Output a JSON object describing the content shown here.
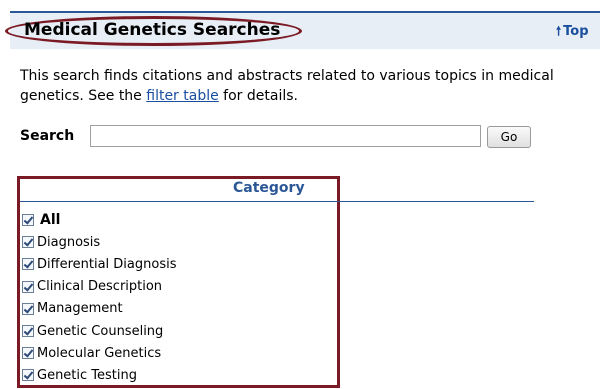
{
  "header": {
    "title": "Medical Genetics Searches",
    "top_link": "Top",
    "top_icon": "up-arrow-icon"
  },
  "description": {
    "before": "This search finds citations and abstracts related to various topics in medical genetics. See the ",
    "link": "filter table",
    "after": " for details."
  },
  "search": {
    "label": "Search",
    "value": "",
    "button": "Go"
  },
  "category": {
    "header": "Category",
    "items": [
      {
        "label": "All",
        "checked": true
      },
      {
        "label": "Diagnosis",
        "checked": true
      },
      {
        "label": "Differential Diagnosis",
        "checked": true
      },
      {
        "label": "Clinical Description",
        "checked": true
      },
      {
        "label": "Management",
        "checked": true
      },
      {
        "label": "Genetic Counseling",
        "checked": true
      },
      {
        "label": "Molecular Genetics",
        "checked": true
      },
      {
        "label": "Genetic Testing",
        "checked": true
      }
    ]
  },
  "colors": {
    "accent": "#2b5797",
    "highlight": "#7a1a24",
    "header_bg": "#e8eef5"
  }
}
